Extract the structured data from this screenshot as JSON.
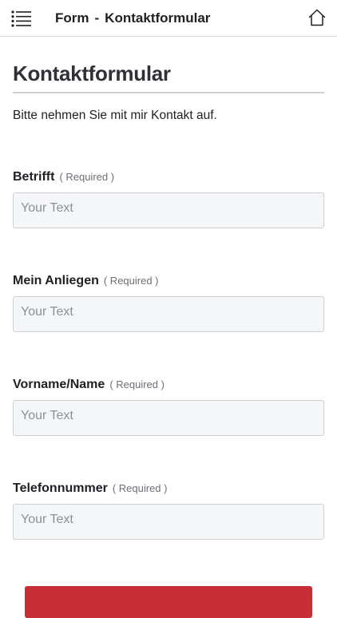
{
  "header": {
    "section": "Form",
    "separator": "-",
    "title": "Kontaktformular",
    "menu_icon": "menu-list-icon",
    "home_icon": "home-icon"
  },
  "page": {
    "heading": "Kontaktformular",
    "intro": "Bitte nehmen Sie mit mir Kontakt auf."
  },
  "fields": [
    {
      "label": "Betrifft",
      "required": "( Required )",
      "placeholder": "Your Text",
      "value": ""
    },
    {
      "label": "Mein Anliegen",
      "required": "( Required )",
      "placeholder": "Your Text",
      "value": ""
    },
    {
      "label": "Vorname/Name",
      "required": "( Required )",
      "placeholder": "Your Text",
      "value": ""
    },
    {
      "label": "Telefonnummer",
      "required": "( Required )",
      "placeholder": "Your Text",
      "value": ""
    }
  ],
  "colors": {
    "accent": "#c62f35",
    "input_background": "#f5f6f8",
    "border": "#cfd0d4"
  }
}
